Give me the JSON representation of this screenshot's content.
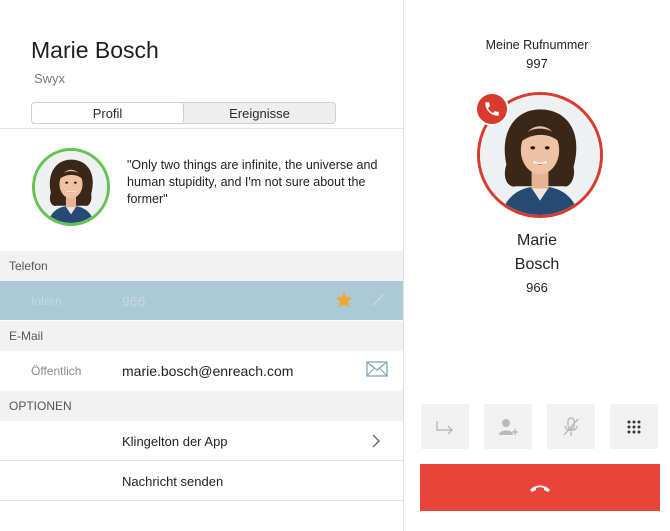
{
  "contact": {
    "name": "Marie Bosch",
    "company": "Swyx",
    "quote": "\"Only two things are infinite, the universe and human stupidity, and I'm not sure about the former\""
  },
  "tabs": [
    {
      "label": "Profil",
      "active": true
    },
    {
      "label": "Ereignisse",
      "active": false
    }
  ],
  "sections": {
    "telefon": "Telefon",
    "email": "E-Mail",
    "optionen": "OPTIONEN"
  },
  "telefon_row": {
    "label": "Intern",
    "value": "966",
    "icon": "star-icon",
    "favorite": true
  },
  "email_row": {
    "label": "Öffentlich",
    "value": "marie.bosch@enreach.com",
    "icon": "mail-icon"
  },
  "options": [
    {
      "label": "Klingelton der App"
    },
    {
      "label": "Nachricht senden"
    }
  ],
  "call": {
    "my_number_label": "Meine Rufnummer",
    "my_number": "997",
    "caller_first": "Marie",
    "caller_last": "Bosch",
    "caller_number": "966"
  },
  "controls": [
    "forward-icon",
    "add-user-icon",
    "mute-microphone-icon",
    "dialpad-icon"
  ],
  "colors": {
    "accent_red": "#e7453a",
    "avatar_ring_green": "#63c452",
    "avatar_ring_red": "#d83a2e",
    "highlight_row": "#acc9d7",
    "star": "#f0a82c"
  }
}
